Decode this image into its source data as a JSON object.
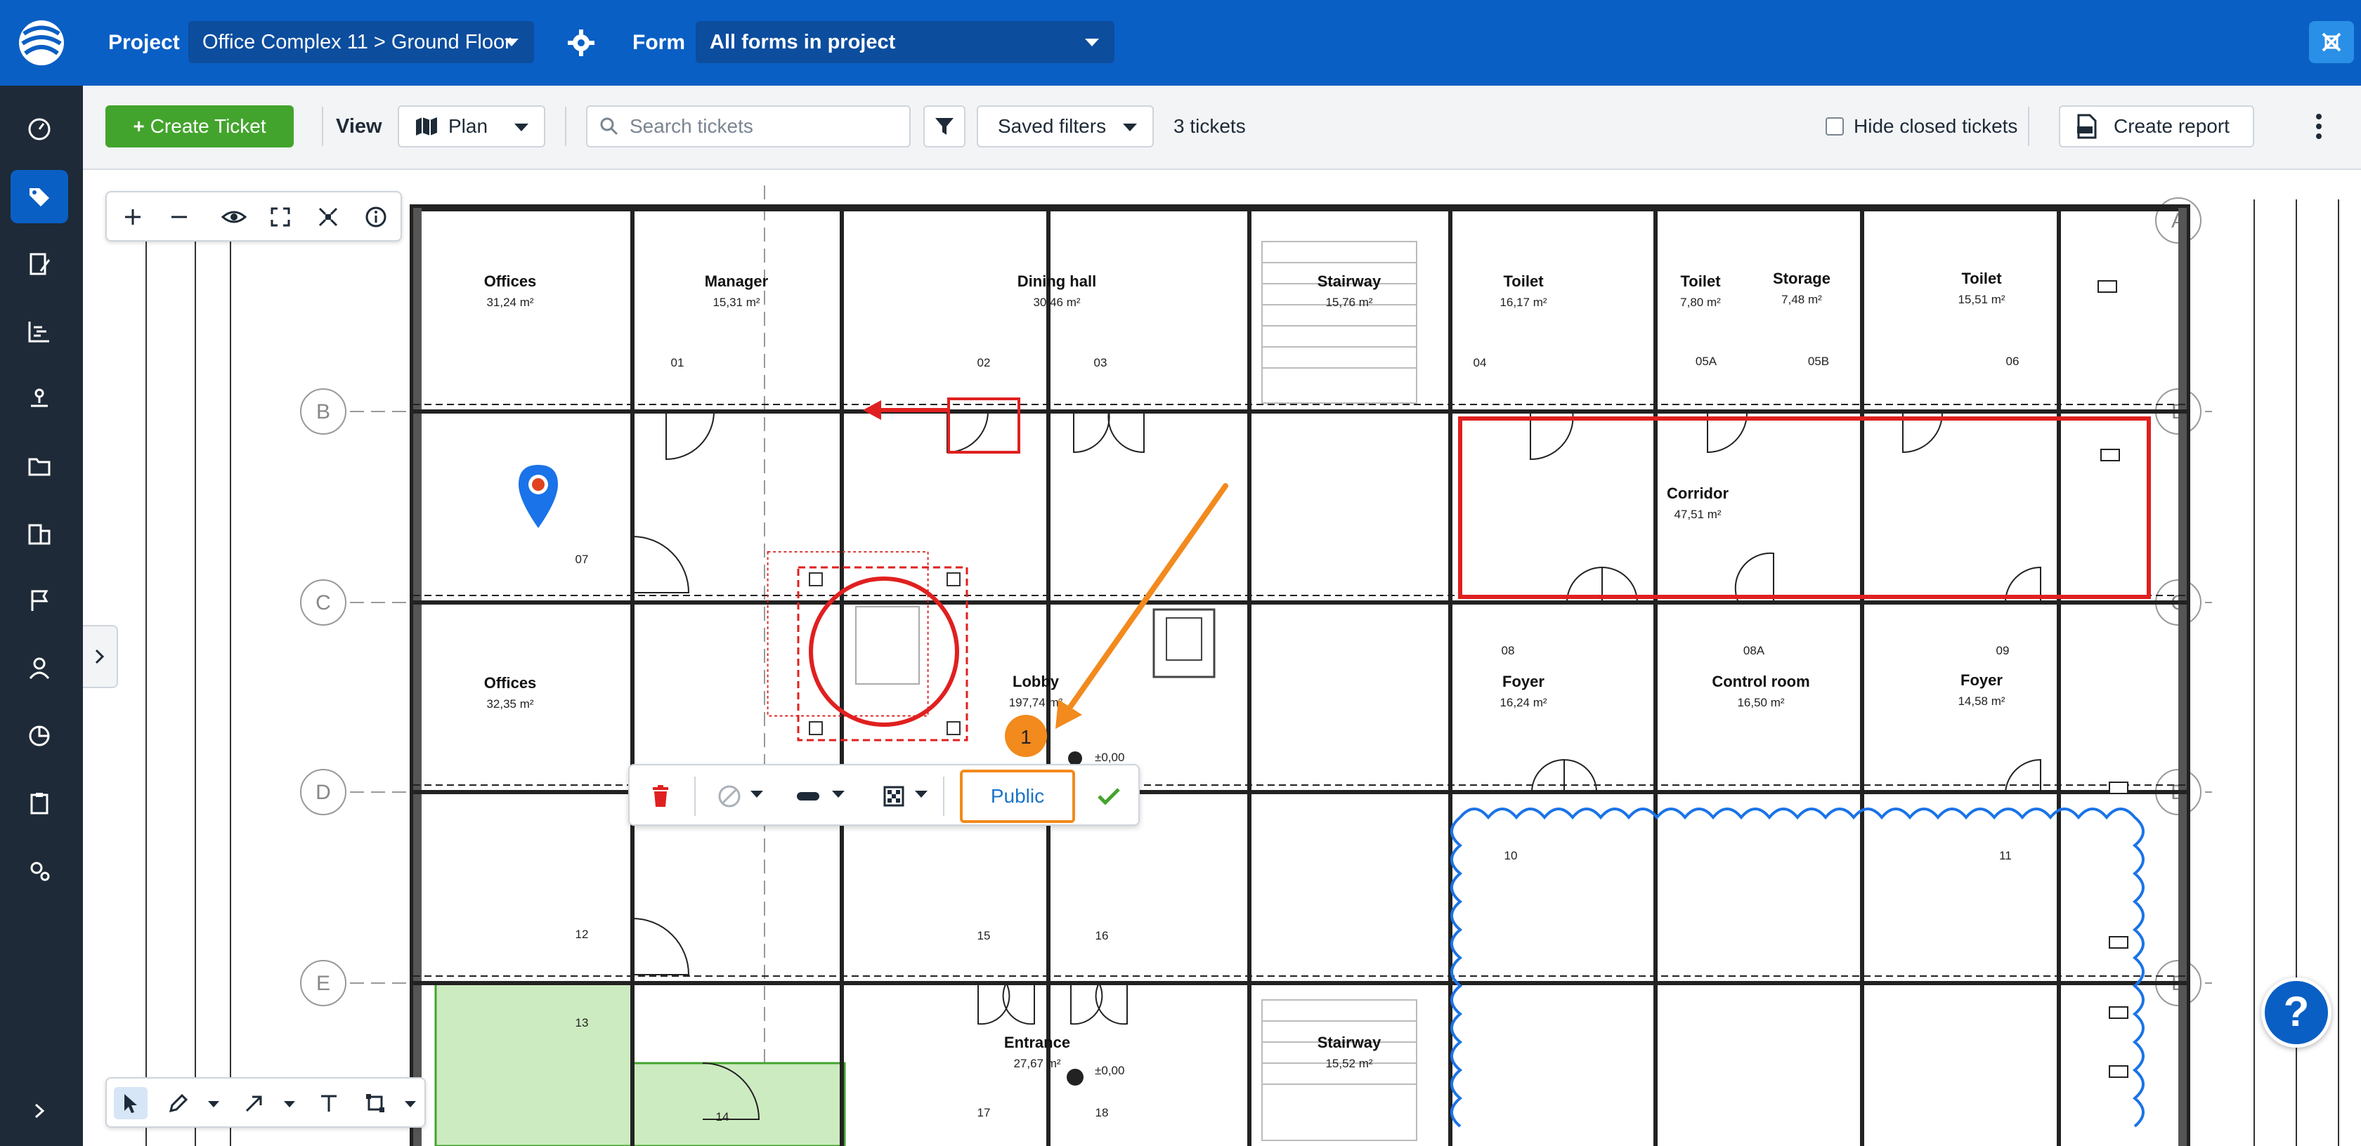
{
  "header": {
    "project_label": "Project",
    "project_value": "Office Complex 11 > Ground Floor",
    "form_label": "Form",
    "form_value": "All forms in project"
  },
  "toolbar": {
    "create_ticket": "Create Ticket",
    "view_label": "View",
    "view_value": "Plan",
    "search_placeholder": "Search tickets",
    "saved_filters": "Saved filters",
    "ticket_count": "3 tickets",
    "hide_closed": "Hide closed tickets",
    "create_report": "Create report"
  },
  "annotation_bar": {
    "visibility": "Public"
  },
  "plan": {
    "marker_number": "1",
    "grid_rows": [
      "A",
      "B",
      "C",
      "D",
      "E"
    ],
    "rooms": [
      {
        "name": "Offices",
        "area": "31,24 m²"
      },
      {
        "name": "Manager",
        "area": "15,31 m²"
      },
      {
        "name": "Dining hall",
        "area": "30,46 m²"
      },
      {
        "name": "Stairway",
        "area": "15,76 m²"
      },
      {
        "name": "Toilet",
        "area": "16,17 m²"
      },
      {
        "name": "Toilet",
        "area": "7,80 m²"
      },
      {
        "name": "Storage",
        "area": "7,48 m²"
      },
      {
        "name": "Toilet",
        "area": "15,51 m²"
      },
      {
        "name": "Corridor",
        "area": "47,51 m²"
      },
      {
        "name": "Offices",
        "area": "32,35 m²"
      },
      {
        "name": "Lobby",
        "area": "197,74 m²"
      },
      {
        "name": "Foyer",
        "area": "16,24 m²"
      },
      {
        "name": "Control room",
        "area": "16,50 m²"
      },
      {
        "name": "Foyer",
        "area": "14,58 m²"
      },
      {
        "name": "Entrance",
        "area": "27,67 m²"
      },
      {
        "name": "Stairway",
        "area": "15,52 m²"
      }
    ],
    "door_labels": [
      "01",
      "02",
      "03",
      "04",
      "05A",
      "05B",
      "06",
      "07",
      "08",
      "08A",
      "09",
      "10",
      "11",
      "12",
      "13",
      "14",
      "15",
      "16",
      "17",
      "18"
    ],
    "level_labels": [
      "±0,00",
      "±0,00"
    ]
  },
  "help": {
    "label": "?"
  },
  "colors": {
    "brand_blue": "#0a5fc4",
    "rail_dark": "#1e2a37",
    "green": "#43a42d",
    "markup_red": "#e02020",
    "arrow_orange": "#f28a1d",
    "cloud_blue": "#1a73e8",
    "area_green": "#cdebc0"
  }
}
